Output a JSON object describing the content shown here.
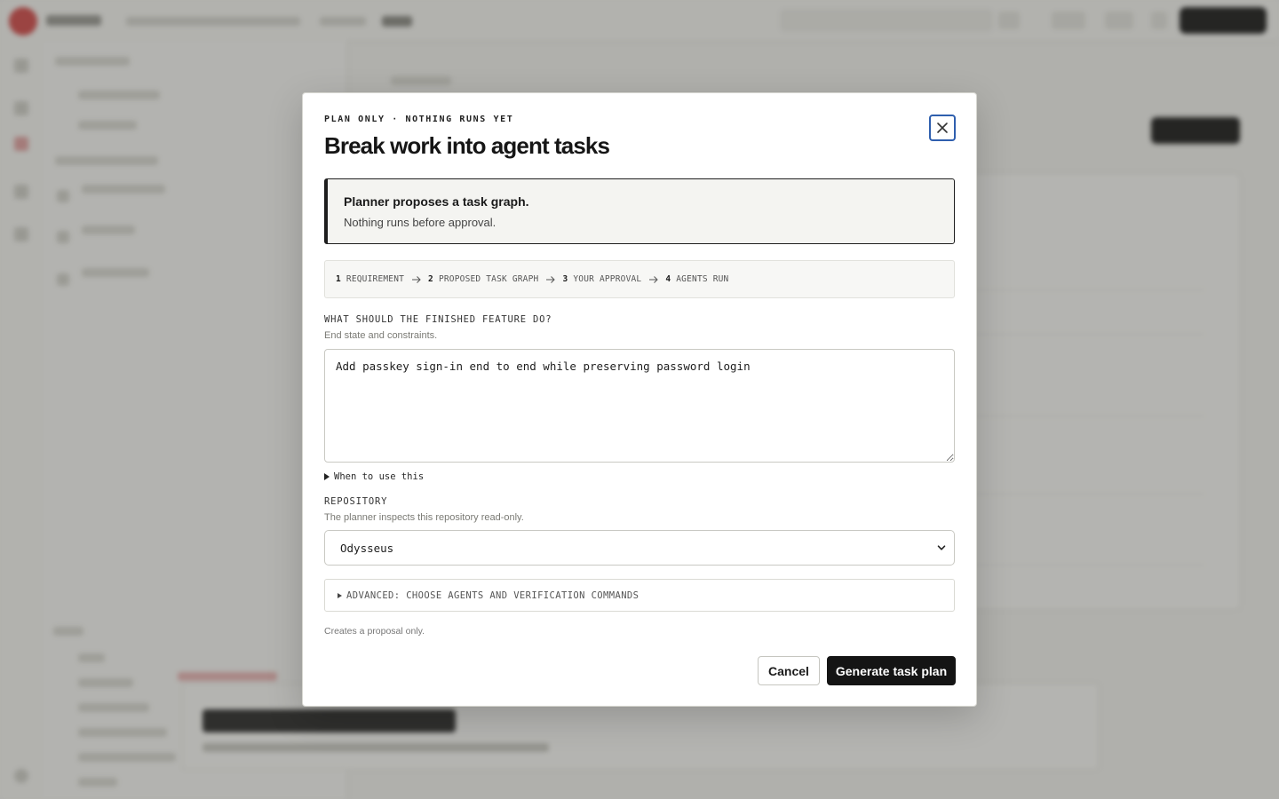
{
  "modal": {
    "eyebrow": "PLAN ONLY · NOTHING RUNS YET",
    "title": "Break work into agent tasks",
    "close_icon": "close-icon",
    "notice": {
      "title": "Planner proposes a task graph.",
      "body": "Nothing runs before approval."
    },
    "steps": [
      {
        "num": "1",
        "label": "REQUIREMENT"
      },
      {
        "num": "2",
        "label": "PROPOSED TASK GRAPH"
      },
      {
        "num": "3",
        "label": "YOUR APPROVAL"
      },
      {
        "num": "4",
        "label": "AGENTS RUN"
      }
    ],
    "requirement": {
      "label": "WHAT SHOULD THE FINISHED FEATURE DO?",
      "help": "End state and constraints.",
      "value": "Add passkey sign-in end to end while preserving password login"
    },
    "when_to_use": "When to use this",
    "repository": {
      "label": "REPOSITORY",
      "help": "The planner inspects this repository read-only.",
      "selected": "Odysseus"
    },
    "advanced_label": "ADVANCED: CHOOSE AGENTS AND VERIFICATION COMMANDS",
    "footnote": "Creates a proposal only.",
    "cancel_label": "Cancel",
    "submit_label": "Generate task plan"
  }
}
